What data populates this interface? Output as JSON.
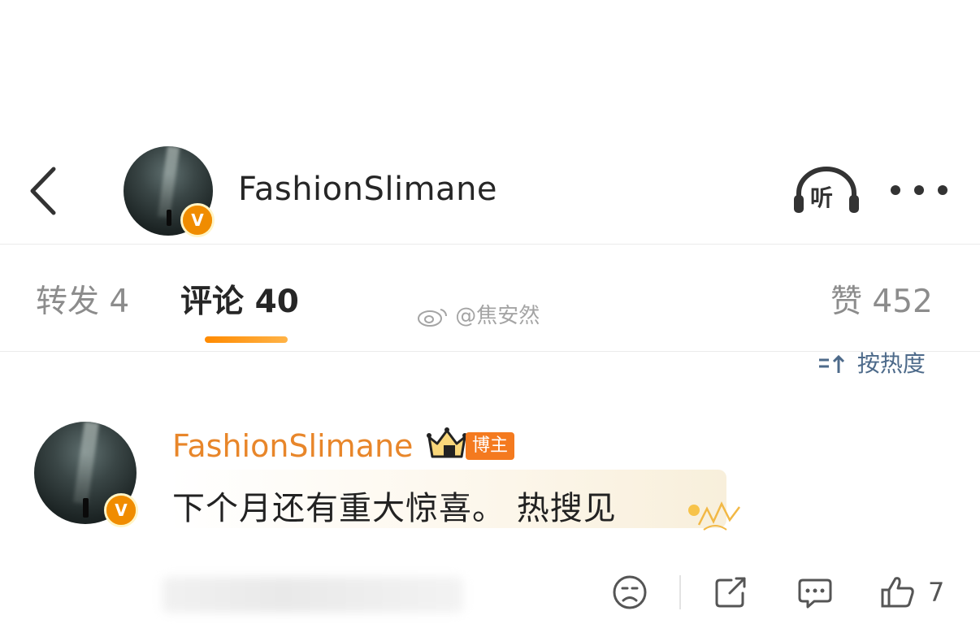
{
  "header": {
    "username": "FashionSlimane",
    "verified_badge": "V",
    "listen_label": "听",
    "icons": [
      "back-arrow-icon",
      "headphones-icon",
      "more-dots-icon"
    ]
  },
  "tabs": {
    "repost": "转发 4",
    "comments": "评论 40",
    "likes": "赞 452"
  },
  "watermark": "@焦安然",
  "sort": {
    "label": "按热度",
    "icon": "sort-arrows-icon"
  },
  "comment": {
    "author": "FashionSlimane",
    "author_badge": "V",
    "role_tag": "博主",
    "text": "下个月还有重大惊喜。 热搜见",
    "like_count": "7",
    "action_icons": [
      "dislike-face-icon",
      "share-icon",
      "reply-bubble-icon",
      "thumbs-up-icon"
    ]
  },
  "colors": {
    "accent_orange": "#ff8a00",
    "name_orange": "#e8862a",
    "tag_orange": "#f47a1f",
    "verified_gold": "#f7b500",
    "sort_blue": "#4d6a8a"
  }
}
